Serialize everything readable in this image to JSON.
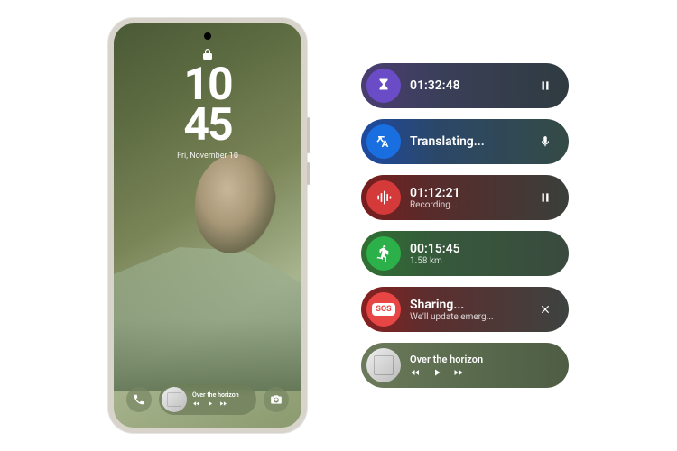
{
  "lockscreen": {
    "time_top": "10",
    "time_bottom": "45",
    "date": "Fri, November 10",
    "player_title": "Over the horizon"
  },
  "pills": {
    "timer": {
      "value": "01:32:48"
    },
    "translate": {
      "label": "Translating..."
    },
    "record": {
      "value": "01:12:21",
      "label": "Recording..."
    },
    "fitness": {
      "value": "00:15:45",
      "label": "1.58 km"
    },
    "sos": {
      "label": "Sharing...",
      "sub": "We'll update emerg..."
    },
    "music": {
      "title": "Over the horizon"
    }
  }
}
